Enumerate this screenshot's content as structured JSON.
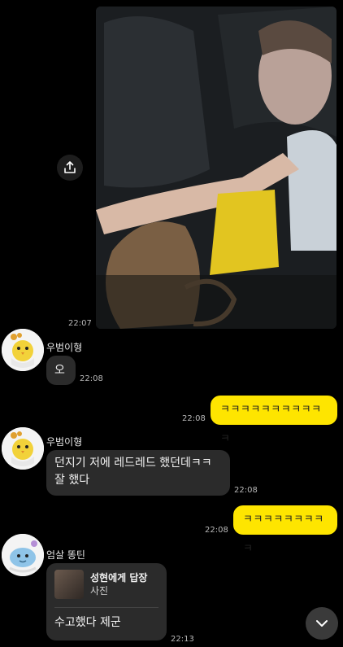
{
  "messages": {
    "photo_time": "22:07",
    "msg1": {
      "sender": "우범이형",
      "text": "오",
      "time": "22:08"
    },
    "msg2": {
      "text": "ㅋㅋㅋㅋㅋㅋㅋㅋㅋㅋㅋ",
      "time": "22:08"
    },
    "msg3": {
      "sender": "우범이형",
      "line1": "던지기 저에 레드레드 했던데ㅋㅋ",
      "line2": "잘 했다",
      "time": "22:08"
    },
    "msg4": {
      "text": "ㅋㅋㅋㅋㅋㅋㅋㅋㅋ",
      "time": "22:08"
    },
    "msg5": {
      "sender": "엄살 똥틴",
      "reply_title": "성현에게 답장",
      "reply_sub": "사진",
      "text": "수고했다 제군",
      "time": "22:13"
    }
  },
  "colors": {
    "outgoing": "#fee500",
    "incoming": "#2b2b2b",
    "background": "#000000"
  },
  "icons": {
    "share": "share-icon",
    "scroll_down": "chevron-down-icon"
  }
}
